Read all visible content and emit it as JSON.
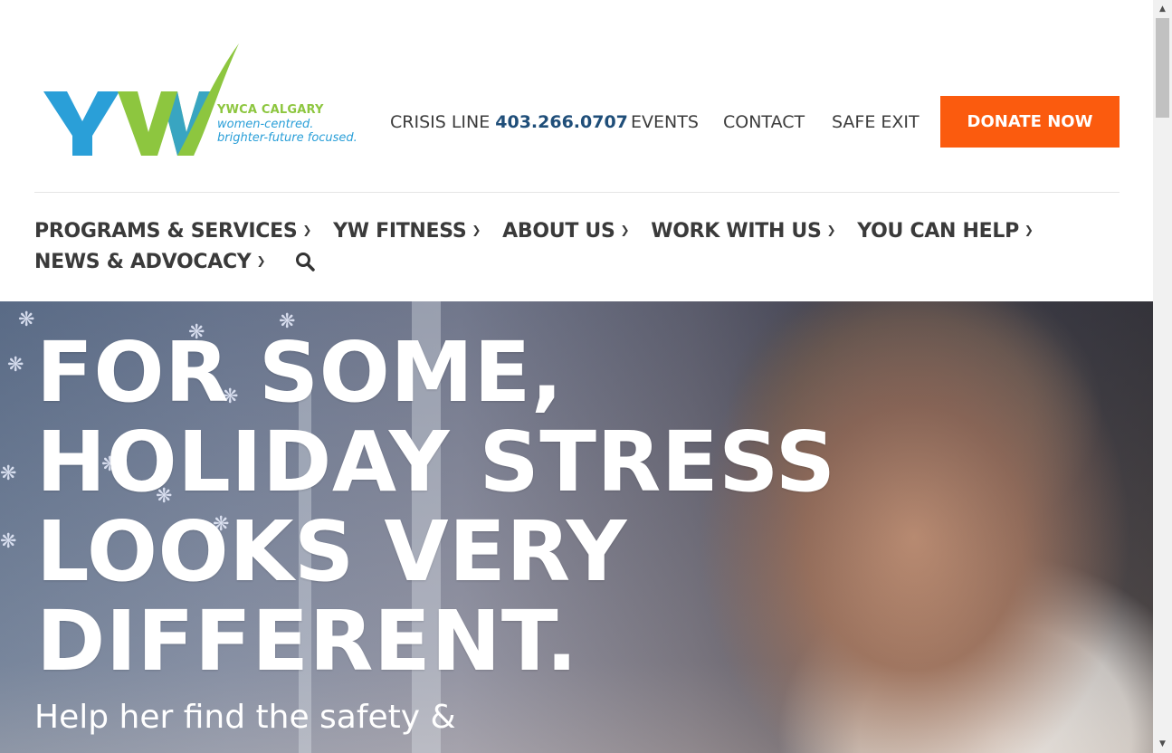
{
  "header": {
    "logo": {
      "org": "YWCA CALGARY",
      "tagline_1": "women-centred.",
      "tagline_2": "brighter-future focused."
    },
    "utility": {
      "crisis_label": "CRISIS LINE",
      "crisis_number": "403.266.0707",
      "events": "EVENTS",
      "contact": "CONTACT",
      "safe_exit": "SAFE EXIT"
    },
    "donate_label": "DONATE NOW"
  },
  "nav": {
    "items": [
      {
        "label": "PROGRAMS & SERVICES"
      },
      {
        "label": "YW FITNESS"
      },
      {
        "label": "ABOUT US"
      },
      {
        "label": "WORK WITH US"
      },
      {
        "label": "YOU CAN HELP"
      },
      {
        "label": "NEWS & ADVOCACY"
      }
    ],
    "search_icon": "search-icon"
  },
  "hero": {
    "headline_lines": [
      "FOR SOME,",
      "HOLIDAY STRESS",
      "LOOKS VERY",
      "DIFFERENT."
    ],
    "subline": "Help her find the safety &"
  },
  "colors": {
    "donate": "#fb5b0e",
    "crisis_number": "#1f4e79",
    "logo_green": "#8dc63f",
    "logo_blue": "#2a9fd8"
  }
}
